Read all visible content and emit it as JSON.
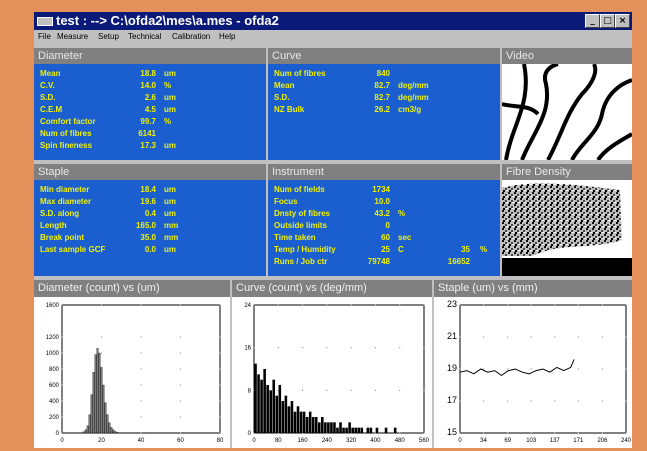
{
  "window": {
    "title": "test :  --> C:\\ofda2\\mes\\a.mes - ofda2",
    "minimize_glyph": "_",
    "maximize_glyph": "□",
    "close_glyph": "×"
  },
  "menu": [
    "File",
    "Measure",
    "Setup",
    "Technical",
    "Calibration",
    "Help"
  ],
  "panels": {
    "diameter": {
      "title": "Diameter",
      "rows": [
        {
          "label": "Mean",
          "value": "18.8",
          "unit": "um"
        },
        {
          "label": "C.V.",
          "value": "14.0",
          "unit": "%"
        },
        {
          "label": "S.D.",
          "value": "2.6",
          "unit": "um"
        },
        {
          "label": "C.E.M",
          "value": "4.5",
          "unit": "um"
        },
        {
          "label": "Comfort factor",
          "value": "99.7",
          "unit": "%"
        },
        {
          "label": "Num of fibres",
          "value": "6141",
          "unit": ""
        },
        {
          "label": "Spin fineness",
          "value": "17.3",
          "unit": "um"
        }
      ]
    },
    "curve": {
      "title": "Curve",
      "rows": [
        {
          "label": "Num of fibres",
          "value": "840",
          "unit": ""
        },
        {
          "label": "Mean",
          "value": "82.7",
          "unit": "deg/mm"
        },
        {
          "label": "S.D.",
          "value": "82.7",
          "unit": "deg/mm"
        },
        {
          "label": "NZ Bulk",
          "value": "26.2",
          "unit": "cm3/g"
        }
      ]
    },
    "video": {
      "title": "Video"
    },
    "staple": {
      "title": "Staple",
      "rows": [
        {
          "label": "Min diameter",
          "value": "18.4",
          "unit": "um"
        },
        {
          "label": "Max diameter",
          "value": "19.6",
          "unit": "um"
        },
        {
          "label": "S.D. along",
          "value": "0.4",
          "unit": "um"
        },
        {
          "label": "Length",
          "value": "165.0",
          "unit": "mm"
        },
        {
          "label": "Break point",
          "value": "35.0",
          "unit": "mm"
        },
        {
          "label": "Last sample GCF",
          "value": "0.0",
          "unit": "um"
        }
      ]
    },
    "instrument": {
      "title": "Instrument",
      "rows": [
        {
          "label": "Num of fields",
          "value": "1734",
          "unit": ""
        },
        {
          "label": "Focus",
          "value": "10.0",
          "unit": ""
        },
        {
          "label": "Dnsty of fibres",
          "value": "43.2",
          "unit": "%"
        },
        {
          "label": "Outside limits",
          "value": "0",
          "unit": ""
        },
        {
          "label": "Time taken",
          "value": "60",
          "unit": "sec"
        },
        {
          "label": "Temp / Humidity",
          "value": "25",
          "unit": "C",
          "value2": "35",
          "unit2": "%"
        },
        {
          "label": "Runs / Job ctr",
          "value": "79748",
          "unit": "",
          "value2": "16652",
          "unit2": ""
        }
      ]
    },
    "density": {
      "title": "Fibre Density"
    }
  },
  "chart_data": [
    {
      "type": "bar",
      "title": "Diameter (count) vs (um)",
      "x_ticks": [
        0,
        20,
        40,
        60,
        80
      ],
      "y_ticks": [
        0,
        200,
        400,
        600,
        800,
        1000,
        1200,
        1600
      ],
      "xlim": [
        0,
        80
      ],
      "ylim": [
        0,
        1600
      ],
      "grid": true,
      "x": [
        10,
        11,
        12,
        13,
        14,
        15,
        16,
        17,
        18,
        19,
        20,
        21,
        22,
        23,
        24,
        25,
        26,
        27,
        28,
        30
      ],
      "values": [
        5,
        15,
        40,
        90,
        230,
        480,
        760,
        980,
        1060,
        1000,
        820,
        600,
        380,
        230,
        130,
        70,
        40,
        20,
        10,
        5
      ]
    },
    {
      "type": "bar",
      "title": "Curve (count) vs (deg/mm)",
      "x_ticks": [
        0,
        80,
        160,
        240,
        320,
        400,
        480,
        560
      ],
      "y_ticks": [
        0,
        8,
        16,
        24
      ],
      "xlim": [
        0,
        560
      ],
      "ylim": [
        0,
        24
      ],
      "grid": true,
      "x": [
        5,
        15,
        25,
        35,
        45,
        55,
        65,
        75,
        85,
        95,
        105,
        115,
        125,
        135,
        145,
        155,
        165,
        175,
        185,
        195,
        205,
        215,
        225,
        235,
        245,
        255,
        265,
        275,
        285,
        295,
        305,
        315,
        325,
        335,
        345,
        355,
        365,
        375,
        385,
        395,
        405,
        415,
        425,
        435,
        445,
        455,
        465
      ],
      "values": [
        13,
        11,
        10,
        12,
        9,
        8,
        10,
        7,
        9,
        6,
        7,
        5,
        6,
        4,
        5,
        4,
        4,
        3,
        4,
        3,
        3,
        2,
        3,
        2,
        2,
        2,
        2,
        1,
        2,
        1,
        1,
        2,
        1,
        1,
        1,
        1,
        0,
        1,
        1,
        0,
        1,
        0,
        0,
        1,
        0,
        0,
        1
      ]
    },
    {
      "type": "line",
      "title": "Staple (um) vs (mm)",
      "x_ticks": [
        0,
        34,
        69,
        103,
        137,
        171,
        206,
        240
      ],
      "y_ticks": [
        15,
        17,
        19,
        21,
        23
      ],
      "xlim": [
        0,
        240
      ],
      "ylim": [
        15,
        23
      ],
      "grid": true,
      "series": [
        {
          "x": [
            0,
            10,
            20,
            30,
            40,
            50,
            60,
            70,
            80,
            90,
            100,
            110,
            120,
            130,
            140,
            150,
            160,
            165
          ],
          "values": [
            18.8,
            18.9,
            18.7,
            19.0,
            18.8,
            18.9,
            18.6,
            18.9,
            19.0,
            18.8,
            18.7,
            18.9,
            19.0,
            18.8,
            19.1,
            18.9,
            19.1,
            19.6
          ]
        }
      ]
    }
  ]
}
